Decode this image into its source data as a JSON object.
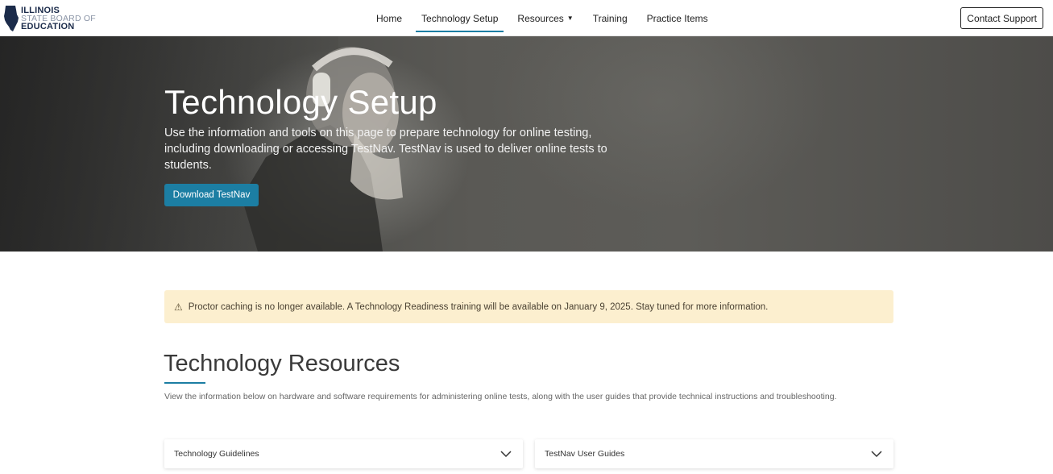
{
  "logo": {
    "line1": "ILLINOIS",
    "line2": "STATE BOARD OF",
    "line3": "EDUCATION"
  },
  "nav": {
    "items": [
      {
        "label": "Home"
      },
      {
        "label": "Technology Setup"
      },
      {
        "label": "Resources"
      },
      {
        "label": "Training"
      },
      {
        "label": "Practice Items"
      }
    ],
    "active": "Technology Setup",
    "contact_label": "Contact Support"
  },
  "hero": {
    "title": "Technology Setup",
    "description": "Use the information and tools on this page to prepare technology for online testing, including downloading or accessing TestNav. TestNav is used to deliver online tests to students.",
    "button_label": "Download TestNav"
  },
  "notice": {
    "icon": "warning-icon",
    "text": "Proctor caching is no longer available. A Technology Readiness training will be available on January 9, 2025. Stay tuned for more information."
  },
  "resources": {
    "title": "Technology Resources",
    "description": "View the information below on hardware and software requirements for administering online tests, along with the user guides that provide technical instructions and troubleshooting.",
    "accordions": [
      {
        "label": "Technology Guidelines"
      },
      {
        "label": "TestNav User Guides"
      }
    ]
  },
  "colors": {
    "accent": "#1c7ea3",
    "notice_bg": "#fcefcf",
    "logo_navy": "#1b2b4a"
  }
}
